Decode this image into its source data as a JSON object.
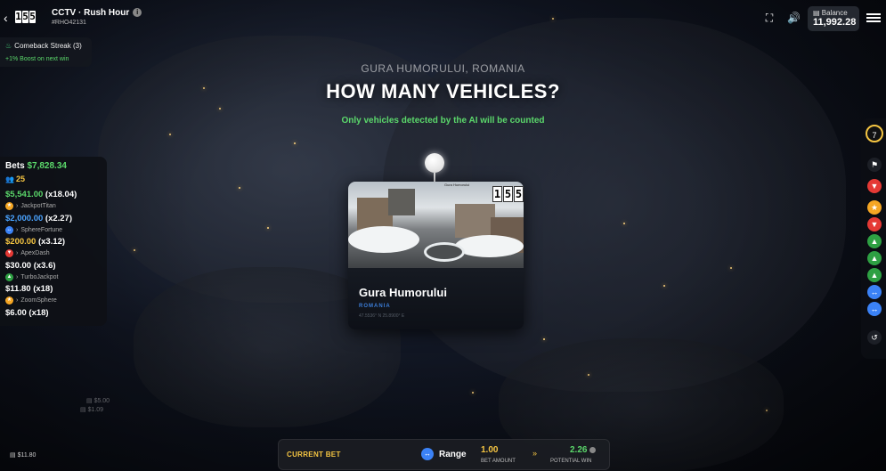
{
  "header": {
    "logo_digits": [
      "1",
      "5",
      "5"
    ],
    "title": "CCTV · Rush Hour",
    "round_id": "#RHO42131",
    "balance_label": "Balance",
    "balance_value": "11,992.28"
  },
  "streak": {
    "title": "Comeback Streak (3)",
    "boost": "+1% Boost on next win"
  },
  "question": {
    "location": "GURA HUMORULUI, ROMANIA",
    "headline": "HOW MANY VEHICLES?",
    "subline": "Only vehicles detected by the AI will be counted"
  },
  "camera_card": {
    "city": "Gura Humorului",
    "country": "ROMANIA",
    "coords": "47.5536° N 25.8900° E",
    "stamp": "Gura Humorului",
    "logo_digits": [
      "1",
      "5",
      "5"
    ]
  },
  "bets": {
    "label": "Bets",
    "total": "$7,828.34",
    "player_count": "25",
    "entries": [
      {
        "amount": "$5,541.00",
        "multiplier": "(x18.04)",
        "user": "JackpotTitan",
        "color": "#5bd86b",
        "badge_color": "#f5a623",
        "badge": "★"
      },
      {
        "amount": "$2,000.00",
        "multiplier": "(x2.27)",
        "user": "SphereFortune",
        "color": "#4aa3ff",
        "badge_color": "#3b82f6",
        "badge": "↔"
      },
      {
        "amount": "$200.00",
        "multiplier": "(x3.12)",
        "user": "ApexDash",
        "color": "#f5c542",
        "badge_color": "#e53935",
        "badge": "▼"
      },
      {
        "amount": "$30.00",
        "multiplier": "(x3.6)",
        "user": "TurboJackpot",
        "color": "#ffffff",
        "badge_color": "#2ea043",
        "badge": "▲"
      },
      {
        "amount": "$11.80",
        "multiplier": "(x18)",
        "user": "ZoomSphere",
        "color": "#ffffff",
        "badge_color": "#f5a623",
        "badge": "★"
      },
      {
        "amount": "$6.00",
        "multiplier": "(x18)",
        "user": "",
        "color": "#ffffff",
        "badge_color": "#f5a623",
        "badge": "★"
      }
    ]
  },
  "ghost_bets": [
    "$5.00",
    "$1.09"
  ],
  "corner_bet": "$11.80",
  "rail": {
    "timer": "7",
    "buttons": [
      {
        "name": "flag-icon",
        "glyph": "⚑",
        "bg": "#1c1f26",
        "fg": "#ffffff"
      },
      {
        "name": "down-red-icon",
        "glyph": "▼",
        "bg": "#e53935",
        "fg": "#ffffff"
      },
      {
        "name": "star-icon",
        "glyph": "★",
        "bg": "#f5a623",
        "fg": "#ffffff"
      },
      {
        "name": "down-red-icon",
        "glyph": "▼",
        "bg": "#e53935",
        "fg": "#ffffff"
      },
      {
        "name": "up-green-icon",
        "glyph": "▲",
        "bg": "#2ea043",
        "fg": "#ffffff"
      },
      {
        "name": "up-green-icon",
        "glyph": "▲",
        "bg": "#2ea043",
        "fg": "#ffffff"
      },
      {
        "name": "up-green-icon",
        "glyph": "▲",
        "bg": "#2ea043",
        "fg": "#ffffff"
      },
      {
        "name": "swap-blue-icon",
        "glyph": "↔",
        "bg": "#3b82f6",
        "fg": "#ffffff"
      },
      {
        "name": "swap-blue-icon",
        "glyph": "↔",
        "bg": "#3b82f6",
        "fg": "#ffffff"
      },
      {
        "name": "history-icon",
        "glyph": "↺",
        "bg": "#1c1f26",
        "fg": "#ffffff"
      }
    ]
  },
  "betbar": {
    "current_bet_label": "CURRENT BET",
    "range_label": "Range",
    "bet_amount_value": "1.00",
    "bet_amount_label": "BET AMOUNT",
    "potential_win_value": "2.26",
    "potential_win_label": "POTENTIAL WIN"
  },
  "colors": {
    "accent_green": "#5bd86b",
    "accent_gold": "#f5c542",
    "accent_blue": "#3b82f6"
  }
}
